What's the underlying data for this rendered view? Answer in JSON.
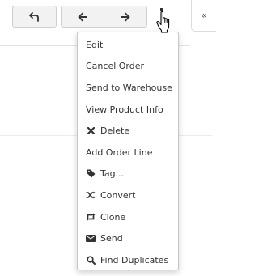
{
  "toolbar": {
    "back_icon": "undo-arrow-icon",
    "prev_icon": "arrow-left-icon",
    "next_icon": "arrow-right-icon",
    "more_icon": "kebab-vertical-icon"
  },
  "side_panel": {
    "collapse_label": "«"
  },
  "menu": {
    "items": [
      {
        "label": "Edit"
      },
      {
        "label": "Cancel Order"
      },
      {
        "label": "Send to Warehouse"
      },
      {
        "label": "View Product Info"
      },
      {
        "label": "Delete",
        "icon": "close-x-icon"
      },
      {
        "label": "Add Order Line"
      },
      {
        "label": "Tag...",
        "icon": "tag-icon"
      },
      {
        "label": "Convert",
        "icon": "shuffle-icon"
      },
      {
        "label": "Clone",
        "icon": "retweet-icon"
      },
      {
        "label": "Send",
        "icon": "envelope-icon"
      },
      {
        "label": "Find Duplicates",
        "icon": "search-icon"
      }
    ]
  }
}
